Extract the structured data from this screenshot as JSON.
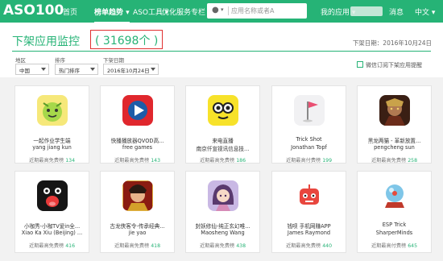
{
  "nav": {
    "logo": "ASO100",
    "items": [
      "首页",
      "榜单趋势 ▾",
      "ASO工具 ▾",
      "优化服务",
      "专栏"
    ],
    "search_prefix": "",
    "search_caret": "▾",
    "search_placeholder": "应用名称或者A",
    "my_apps": "我的应用 ▾",
    "messages": "消息",
    "language": "中文 ▾"
  },
  "header": {
    "title": "下架应用监控",
    "count": "( 31698个 )",
    "date": "下架日期：2016年10月24日"
  },
  "filters": {
    "region_label": "地区",
    "region_value": "中国",
    "sort_label": "排序",
    "sort_value": "热门排序",
    "date_label": "下架日期",
    "date_value": "2016年10月24日",
    "subscribe": "微信订阅下架应用提醒"
  },
  "apps": [
    {
      "name": "一起作业学生端",
      "dev": "yang jiang kun",
      "stat": "近期最高免费榜",
      "rank": "134",
      "icon": "face-icon"
    },
    {
      "name": "快播播放器QVOD高...",
      "dev": "free games",
      "stat": "近期最高免费榜",
      "rank": "143",
      "icon": "play-icon"
    },
    {
      "name": "来电直播",
      "dev": "南京仟宣视讯信息技...",
      "stat": "近期最高免费榜",
      "rank": "186",
      "icon": "glasses-icon"
    },
    {
      "name": "Trick Shot",
      "dev": "Jonathan Topf",
      "stat": "近期最高付费榜",
      "rank": "199",
      "icon": "flag-icon"
    },
    {
      "name": "黑龙两猫 - 革新放置...",
      "dev": "pengcheng sun",
      "stat": "近期最高免费榜",
      "rank": "258",
      "icon": "warrior-icon"
    },
    {
      "name": "小咖秀-小咖TV爱in全...",
      "dev": "Xiao Ka Xiu (Beijing) ...",
      "stat": "近期最高免费榜",
      "rank": "416",
      "icon": "mouth-icon"
    },
    {
      "name": "古龙侠客令-传承经典...",
      "dev": "jie yao",
      "stat": "近期最高免费榜",
      "rank": "418",
      "icon": "hero-icon"
    },
    {
      "name": "封妖修仙-纯正玄幻唯...",
      "dev": "Maosheng Wang",
      "stat": "近期最高免费榜",
      "rank": "438",
      "icon": "girl-icon"
    },
    {
      "name": "钱呗 手机网赚APP",
      "dev": "James Raymond",
      "stat": "近期最高免费榜",
      "rank": "440",
      "icon": "robot-icon"
    },
    {
      "name": "ESP Trick",
      "dev": "SharperMinds",
      "stat": "近期最高付费榜",
      "rank": "645",
      "icon": "crystal-icon"
    }
  ]
}
